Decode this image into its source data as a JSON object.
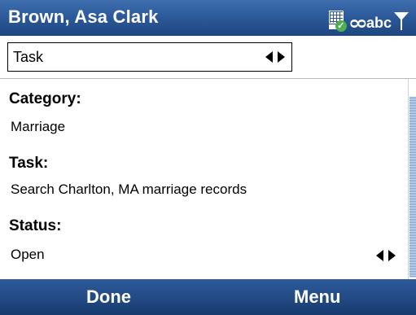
{
  "window": {
    "title": "Brown, Asa Clark",
    "status_icons": [
      "network-sync-icon",
      "voicemail-icon",
      "abc-input-mode-icon",
      "signal-strength-icon"
    ],
    "status_text": {
      "voicemail": "ᴑᴑ",
      "input_mode": "abc"
    }
  },
  "type_selector": {
    "value": "Task"
  },
  "fields": {
    "category": {
      "label": "Category:",
      "value": "Marriage"
    },
    "task": {
      "label": "Task:",
      "value": "Search Charlton, MA marriage records"
    },
    "status": {
      "label": "Status:",
      "value": "Open"
    }
  },
  "softkeys": {
    "left": "Done",
    "right": "Menu"
  },
  "colors": {
    "bar_blue": "#2d5a9a",
    "text": "#000000",
    "background": "#ffffff"
  }
}
